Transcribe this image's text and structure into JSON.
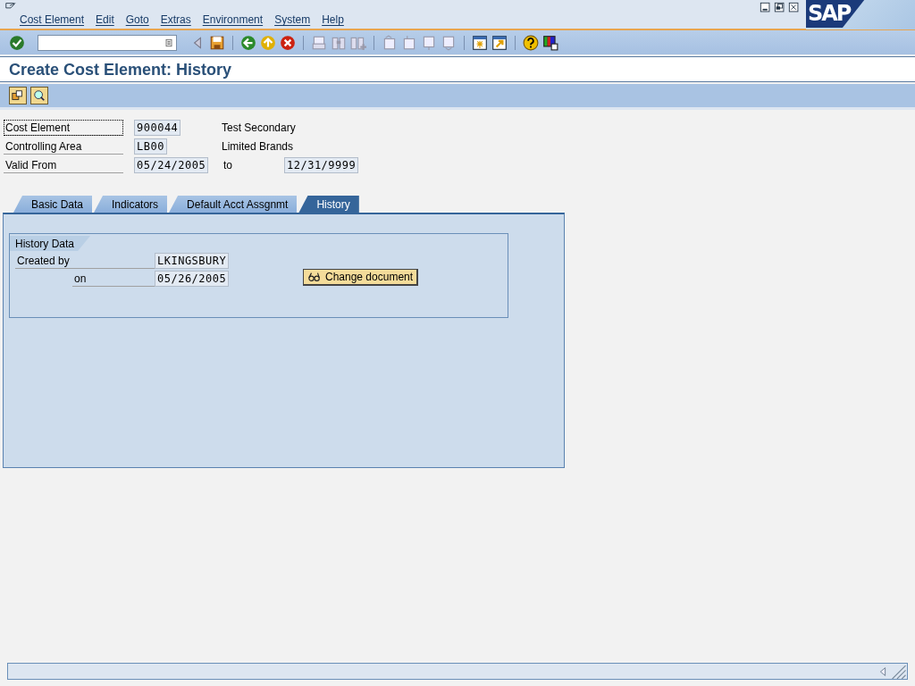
{
  "menu": [
    "Cost Element",
    "Edit",
    "Goto",
    "Extras",
    "Environment",
    "System",
    "Help"
  ],
  "logo": "SAP",
  "title": "Create Cost Element: History",
  "header": [
    {
      "label": "Cost Element",
      "value": "900044",
      "description": "Test Secondary",
      "focused": true
    },
    {
      "label": "Controlling Area",
      "value": "LB00",
      "description": "Limited Brands",
      "focused": false
    },
    {
      "label": "Valid From",
      "value": "05/24/2005",
      "to_label": "to",
      "to_value": "12/31/9999",
      "focused": false
    }
  ],
  "tabs": [
    {
      "label": "Basic Data",
      "selected": false
    },
    {
      "label": "Indicators",
      "selected": false
    },
    {
      "label": "Default Acct Assgnmt",
      "selected": false
    },
    {
      "label": "History",
      "selected": true
    }
  ],
  "group": {
    "title": "History Data",
    "fields": [
      {
        "label": "Created by",
        "value": "LKINGSBURY",
        "kind": "main"
      },
      {
        "label": "on",
        "value": "05/26/2005",
        "kind": "sub"
      }
    ],
    "button": "Change document"
  }
}
